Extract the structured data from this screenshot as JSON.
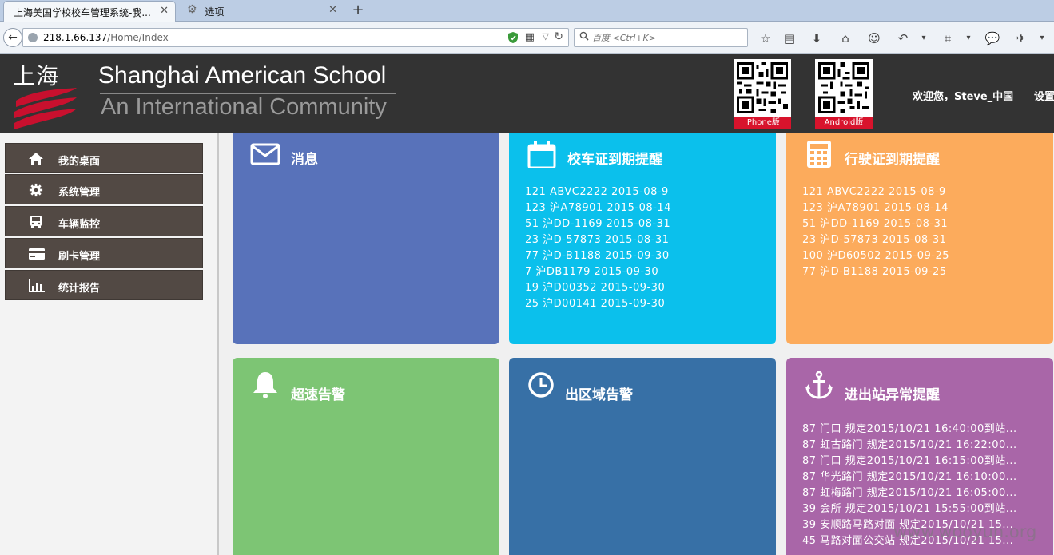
{
  "browser": {
    "tabs": [
      {
        "title": "上海美国学校校车管理系统-我...",
        "active": true
      },
      {
        "title": "选项",
        "active": false
      }
    ],
    "url_host": "218.1.66.137",
    "url_path": "/Home/Index",
    "search_placeholder": "百度 <Ctrl+K>"
  },
  "header": {
    "logo_cn": "上海",
    "school_name": "Shanghai American School",
    "tagline": "An International Community",
    "qr_iphone_label": "iPhone版",
    "qr_android_label": "Android版",
    "welcome": "欢迎您，Steve_中国",
    "settings": "设置",
    "brand_red": "#d8132c"
  },
  "sidebar": {
    "items": [
      {
        "label": "我的桌面",
        "icon": "home-icon"
      },
      {
        "label": "系统管理",
        "icon": "gear-icon"
      },
      {
        "label": "车辆监控",
        "icon": "bus-icon"
      },
      {
        "label": "刷卡管理",
        "icon": "card-icon"
      },
      {
        "label": "统计报告",
        "icon": "bar-chart-icon"
      }
    ]
  },
  "cards": {
    "messages": {
      "title": "消息",
      "icon": "envelope-icon",
      "color": "#5872ba",
      "items": []
    },
    "bus_cert": {
      "title": "校车证到期提醒",
      "icon": "calendar-icon",
      "color": "#0bc0ec",
      "items": [
        "121  ABVC2222  2015-08-9",
        "123  沪A78901  2015-08-14",
        "51  沪DD-1169  2015-08-31",
        "23  沪D-57873  2015-08-31",
        "77  沪D-B1188  2015-09-30",
        "7  沪DB1179  2015-09-30",
        "19  沪D00352  2015-09-30",
        "25  沪D00141  2015-09-30"
      ]
    },
    "driver_cert": {
      "title": "行驶证到期提醒",
      "icon": "calculator-icon",
      "color": "#fcab5c",
      "items": [
        "121  ABVC2222  2015-08-9",
        "123  沪A78901  2015-08-14",
        "51  沪DD-1169  2015-08-31",
        "23  沪D-57873  2015-08-31",
        "100  沪D60502  2015-09-25",
        "77  沪D-B1188  2015-09-25"
      ]
    },
    "speeding": {
      "title": "超速告警",
      "icon": "bell-icon",
      "color": "#7dc574",
      "items": []
    },
    "zone": {
      "title": "出区域告警",
      "icon": "clock-icon",
      "color": "#3770a6",
      "items": []
    },
    "station": {
      "title": "进出站异常提醒",
      "icon": "anchor-icon",
      "color": "#a966a8",
      "items": [
        "87  门口  规定2015/10/21 16:40:00到站...",
        "87  虹古路门  规定2015/10/21 16:22:00...",
        "87  门口  规定2015/10/21 16:15:00到站...",
        "87  华光路门  规定2015/10/21 16:10:00...",
        "87  虹梅路门  规定2015/10/21 16:05:00...",
        "39  会所  规定2015/10/21 15:55:00到站...",
        "39  安顺路马路对面  规定2015/10/21 15...",
        "45  马路对面公交站  规定2015/10/21 15..."
      ]
    }
  },
  "watermark": "www.wooyun.org"
}
